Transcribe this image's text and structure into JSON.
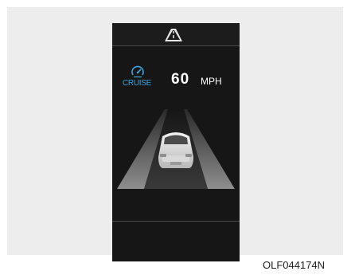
{
  "cluster": {
    "cruise_label": "CRUISE",
    "speed_value": "60",
    "speed_unit": "MPH"
  },
  "caption": "OLF044174N",
  "icons": {
    "top": "lane-road-icon",
    "cruise": "cruise-speedometer-icon",
    "vehicle": "car-rear-icon"
  },
  "colors": {
    "cruise_accent": "#3ea3dc",
    "screen_background": "#161616",
    "text": "#ffffff"
  }
}
